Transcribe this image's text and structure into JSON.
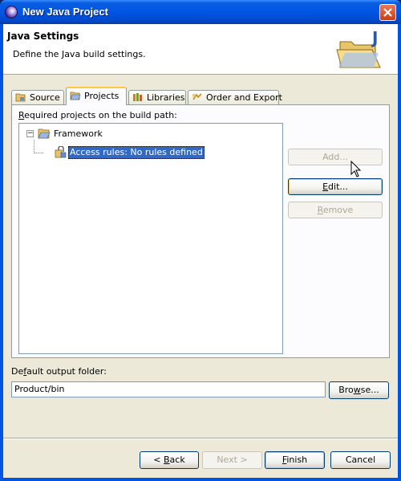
{
  "window": {
    "title": "New Java Project"
  },
  "header": {
    "title": "Java Settings",
    "description": "Define the Java build settings."
  },
  "tabs": [
    {
      "label": "Source",
      "icon": "source-folder-icon",
      "active": false
    },
    {
      "label": "Projects",
      "icon": "projects-folder-icon",
      "active": true
    },
    {
      "label": "Libraries",
      "icon": "libraries-icon",
      "active": false
    },
    {
      "label": "Order and Export",
      "icon": "order-export-icon",
      "active": false
    }
  ],
  "projects": {
    "list_label_accel": "R",
    "list_label_rest": "equired projects on the build path:",
    "tree": {
      "root_label": "Framework",
      "expander": "−",
      "child_label": "Access rules: No rules defined"
    },
    "buttons": {
      "add": "Add...",
      "edit_accel": "E",
      "edit_rest": "dit...",
      "remove_accel": "R",
      "remove_rest": "emove"
    }
  },
  "output": {
    "label_accel": "f",
    "label_pre": "De",
    "label_rest": "ault output folder:",
    "value": "Product/bin",
    "browse_pre": "Bro",
    "browse_accel": "w",
    "browse_rest": "se..."
  },
  "footer": {
    "back_pre": "< ",
    "back_accel": "B",
    "back_rest": "ack",
    "next_label": "Next >",
    "finish_accel": "F",
    "finish_rest": "inish",
    "cancel_label": "Cancel"
  },
  "colors": {
    "title_bar": "#0055e5",
    "selection": "#316ac5",
    "dialog_bg": "#ece9d8",
    "active_tab_highlight": "#ffc83c"
  }
}
